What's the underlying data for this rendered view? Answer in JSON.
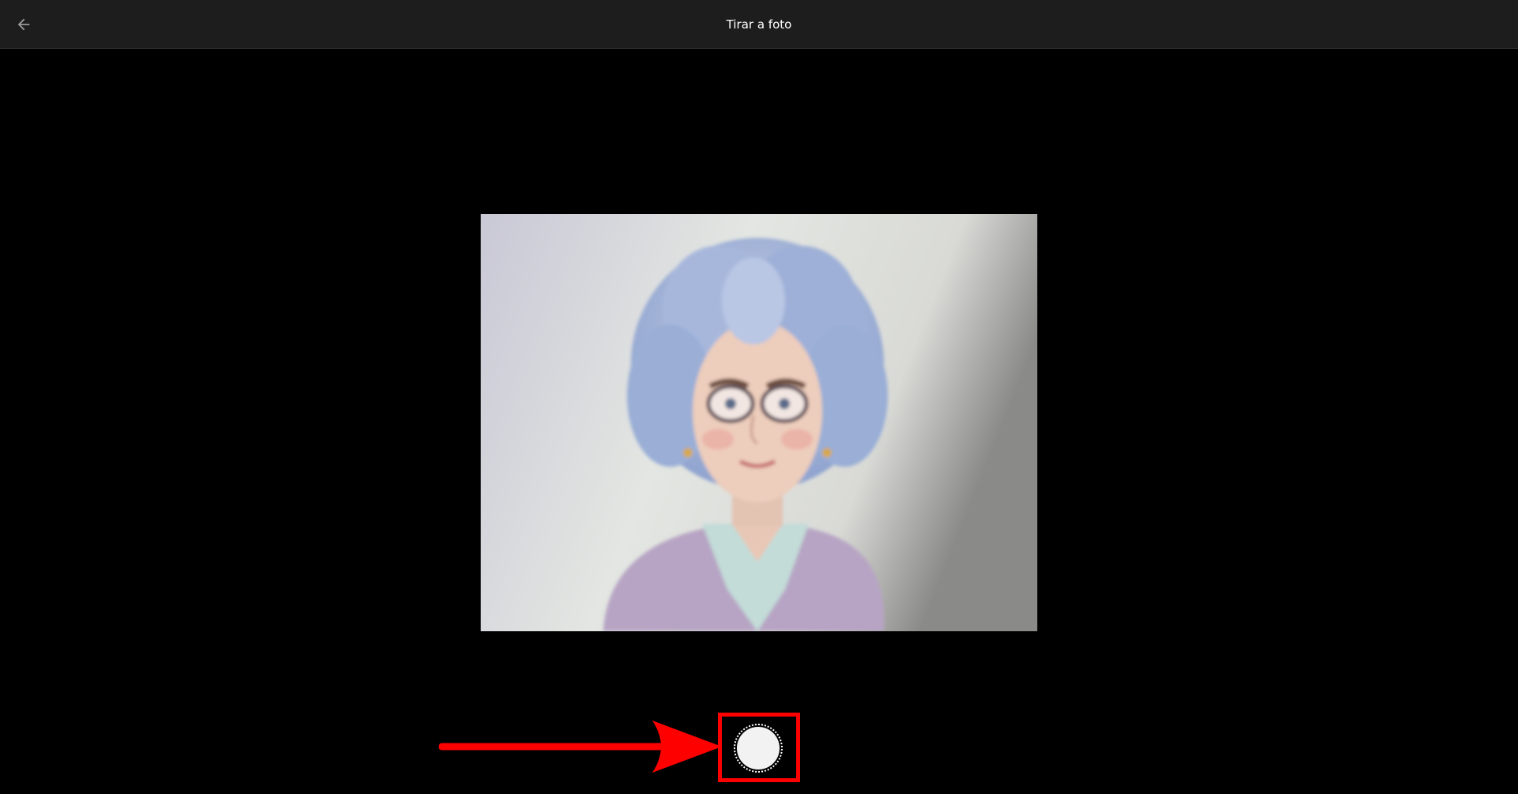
{
  "header": {
    "title": "Tirar a foto",
    "back_icon": "arrow-left-icon"
  },
  "camera": {
    "preview_icon": "camera-preview-image",
    "shutter_icon": "shutter-button-icon"
  },
  "annotation": {
    "color": "#ff0000",
    "arrow_icon": "arrow-right-icon"
  },
  "colors": {
    "topbar": "#1d1d1d",
    "background": "#000000",
    "title_text": "#ffffff"
  }
}
